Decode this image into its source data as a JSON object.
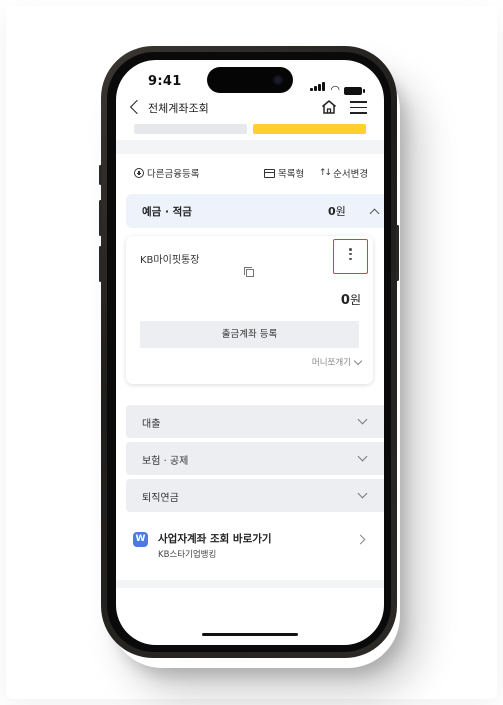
{
  "status": {
    "time": "9:41"
  },
  "nav": {
    "title": "전체계좌조회"
  },
  "toolbar": {
    "add_label": "다른금융등록",
    "list_label": "목록형",
    "order_label": "순서변경"
  },
  "deposit_section": {
    "title": "예금 · 적금",
    "amount": "0",
    "unit": "원"
  },
  "account": {
    "name": "KB마이핏통장",
    "balance": "0",
    "unit": "원",
    "withdraw_button": "출금계좌 등록",
    "money_link": "머니쪼개기"
  },
  "sections": [
    {
      "label": "대출"
    },
    {
      "label": "보험 · 공제"
    },
    {
      "label": "퇴직연금"
    }
  ],
  "business": {
    "icon_text": "W",
    "title": "사업자계좌 조회 바로가기",
    "subtitle": "KB스타기업뱅킹"
  },
  "colors": {
    "accent_yellow": "#ffd02e",
    "highlight_red": "#e2364a",
    "section_bg": "#eef3fb",
    "biz_icon": "#4d7ae0"
  }
}
